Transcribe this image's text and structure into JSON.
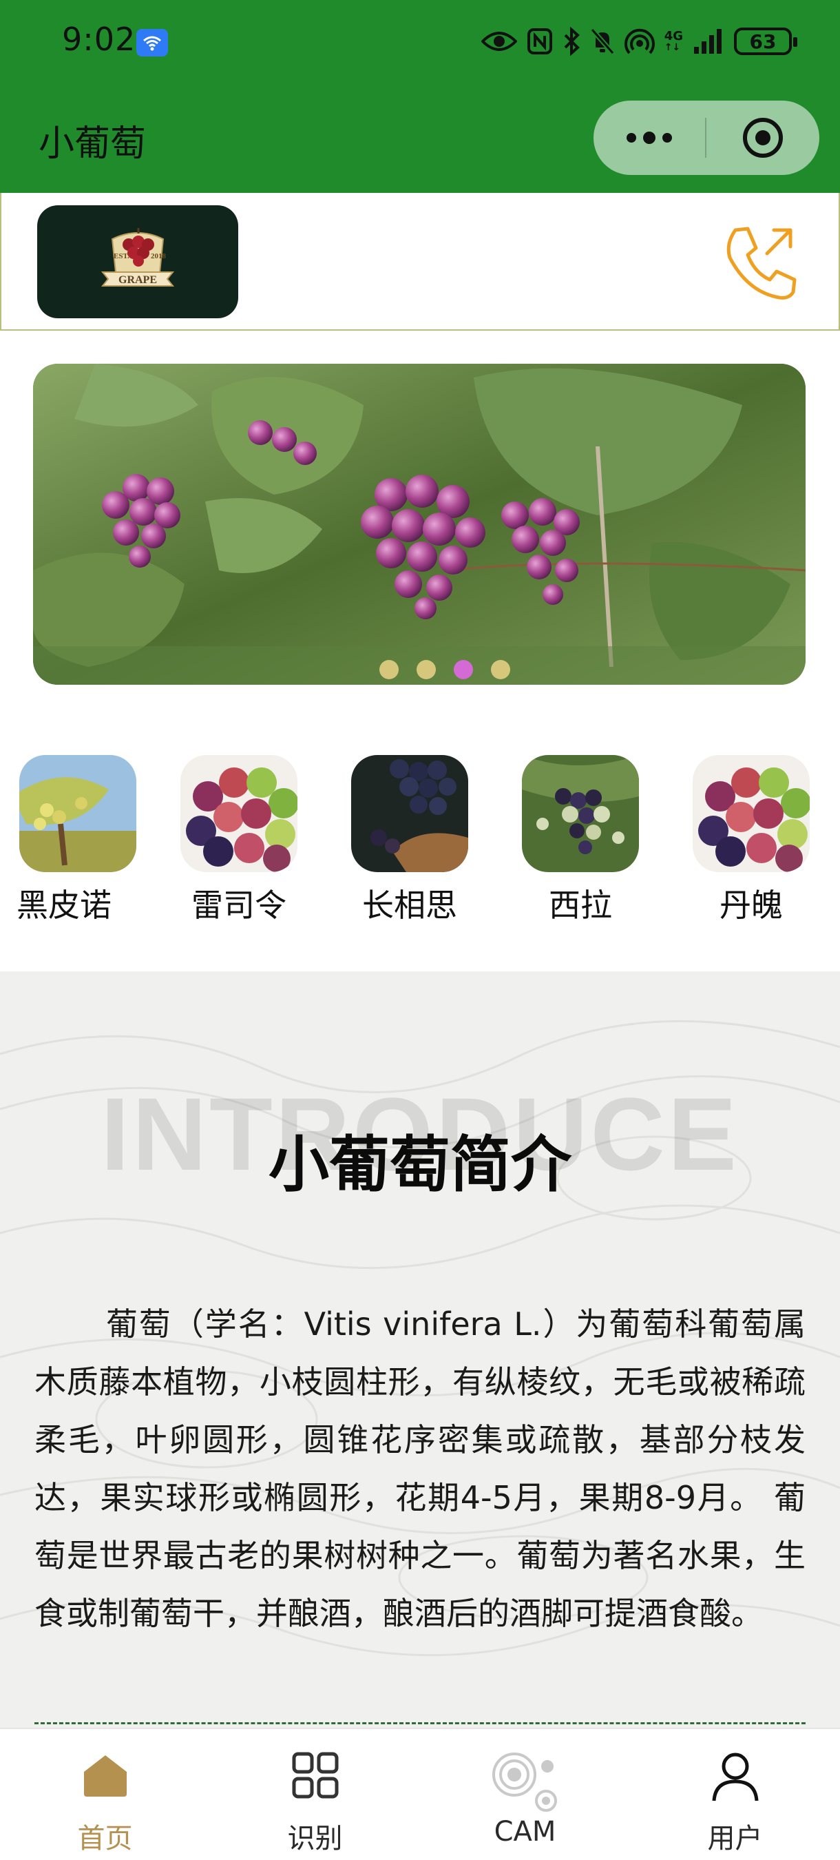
{
  "status_bar": {
    "time": "9:02",
    "battery": "63",
    "network_label": "4G",
    "icons": [
      "wifi-icon",
      "eye-icon",
      "nfc-icon",
      "bluetooth-icon",
      "mute-icon",
      "hotspot-icon",
      "signal-icon",
      "battery-icon"
    ]
  },
  "nav": {
    "title": "小葡萄",
    "menu_icon": "more-dots-icon",
    "close_icon": "target-close-icon"
  },
  "header": {
    "logo_icon": "grape-logo",
    "logo_text": "GRAPE",
    "logo_est": "EST.",
    "logo_year": "2018",
    "phone_icon": "phone-call-icon"
  },
  "banner": {
    "slide_count": 4,
    "active_index": 2,
    "colors": {
      "dot": "#d6c77c",
      "dot_active": "#d46ad4"
    }
  },
  "varieties": [
    {
      "name": "黑皮诺"
    },
    {
      "name": "雷司令"
    },
    {
      "name": "长相思"
    },
    {
      "name": "西拉"
    },
    {
      "name": "丹魄"
    }
  ],
  "intro": {
    "watermark": "INTRODUCE",
    "title": "小葡萄简介",
    "body": "葡萄（学名：Vitis vinifera L.）为葡萄科葡萄属木质藤本植物，小枝圆柱形，有纵棱纹，无毛或被稀疏柔毛，叶卵圆形，圆锥花序密集或疏散，基部分枝发达，果实球形或椭圆形，花期4-5月，果期8-9月。 葡萄是世界最古老的果树树种之一。葡萄为著名水果，生食或制葡萄干，并酿酒，酿酒后的酒脚可提酒食酸。"
  },
  "tabs": [
    {
      "label": "首页",
      "icon": "home-icon",
      "active": true
    },
    {
      "label": "识别",
      "icon": "grid-icon",
      "active": false
    },
    {
      "label": "CAM",
      "icon": "cam-icon",
      "active": false
    },
    {
      "label": "用户",
      "icon": "user-icon",
      "active": false
    }
  ],
  "colors": {
    "brand_green": "#1f8b2b",
    "accent_gold": "#b59150",
    "phone_orange": "#f0a020"
  }
}
